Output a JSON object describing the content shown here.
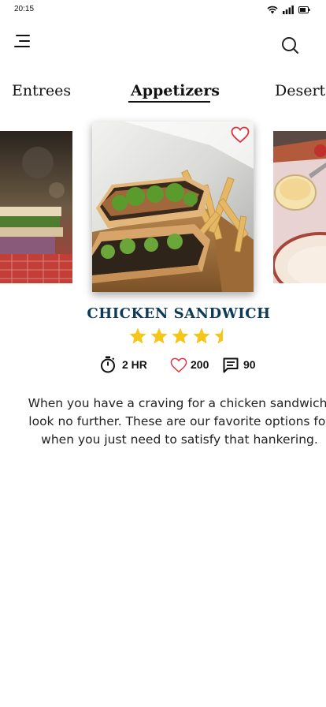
{
  "status": {
    "time": "20:15",
    "icons": [
      "wifi-icon",
      "signal-icon",
      "battery-icon"
    ]
  },
  "header": {
    "menu_icon": "menu-icon",
    "search_icon": "search-icon"
  },
  "tabs": [
    {
      "label": "Entrees",
      "active": false
    },
    {
      "label": "Appetizers",
      "active": true
    },
    {
      "label": "Desert",
      "active": false
    }
  ],
  "carousel": {
    "items": [
      {
        "image": "sandwich-photo-left"
      },
      {
        "image": "chicken-sandwich-photo",
        "favorite_icon": "heart-outline-icon"
      },
      {
        "image": "dessert-bowl-photo-right"
      }
    ]
  },
  "item": {
    "title": "CHICKEN SANDWICH",
    "rating": 4.5,
    "stats": {
      "time": "2 HR",
      "likes": "200",
      "comments": "90"
    },
    "description": "When you have a craving for a chicken sandwich, look no further. These are our favorite options for when you just need to satisfy that hankering."
  },
  "colors": {
    "title": "#0e3a58",
    "star": "#f5c518",
    "heart": "#e0303a"
  }
}
